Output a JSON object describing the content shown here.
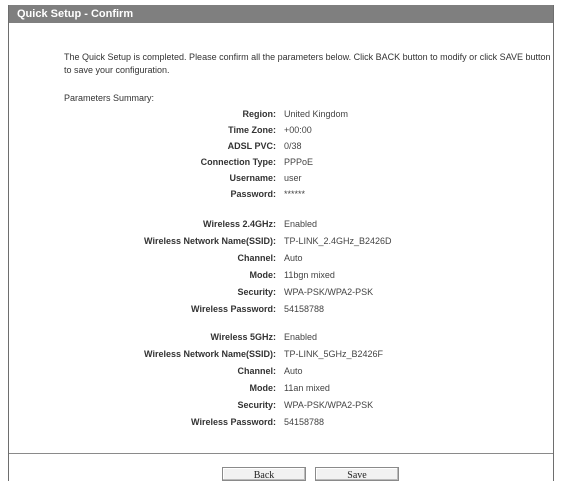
{
  "header": {
    "title": "Quick Setup - Confirm"
  },
  "intro": "The Quick Setup is completed. Please confirm all the parameters below. Click BACK button to modify or click SAVE button to save your configuration.",
  "summary_label": "Parameters Summary:",
  "params": [
    {
      "label": "Region:",
      "value": "United Kingdom"
    },
    {
      "label": "Time Zone:",
      "value": "+00:00"
    },
    {
      "label": "ADSL PVC:",
      "value": "0/38"
    },
    {
      "label": "Connection Type:",
      "value": "PPPoE"
    },
    {
      "label": "Username:",
      "value": "user"
    },
    {
      "label": "Password:",
      "value": "******"
    },
    {
      "label": "Wireless 2.4GHz:",
      "value": "Enabled"
    },
    {
      "label": "Wireless Network Name(SSID):",
      "value": "TP-LINK_2.4GHz_B2426D"
    },
    {
      "label": "Channel:",
      "value": "Auto"
    },
    {
      "label": "Mode:",
      "value": "11bgn mixed"
    },
    {
      "label": "Security:",
      "value": "WPA-PSK/WPA2-PSK"
    },
    {
      "label": "Wireless Password:",
      "value": "54158788"
    },
    {
      "label": "Wireless 5GHz:",
      "value": "Enabled"
    },
    {
      "label": "Wireless Network Name(SSID):",
      "value": "TP-LINK_5GHz_B2426F"
    },
    {
      "label": "Channel:",
      "value": "Auto"
    },
    {
      "label": "Mode:",
      "value": "11an mixed"
    },
    {
      "label": "Security:",
      "value": "WPA-PSK/WPA2-PSK"
    },
    {
      "label": "Wireless Password:",
      "value": "54158788"
    }
  ],
  "buttons": {
    "back": "Back",
    "save": "Save"
  }
}
